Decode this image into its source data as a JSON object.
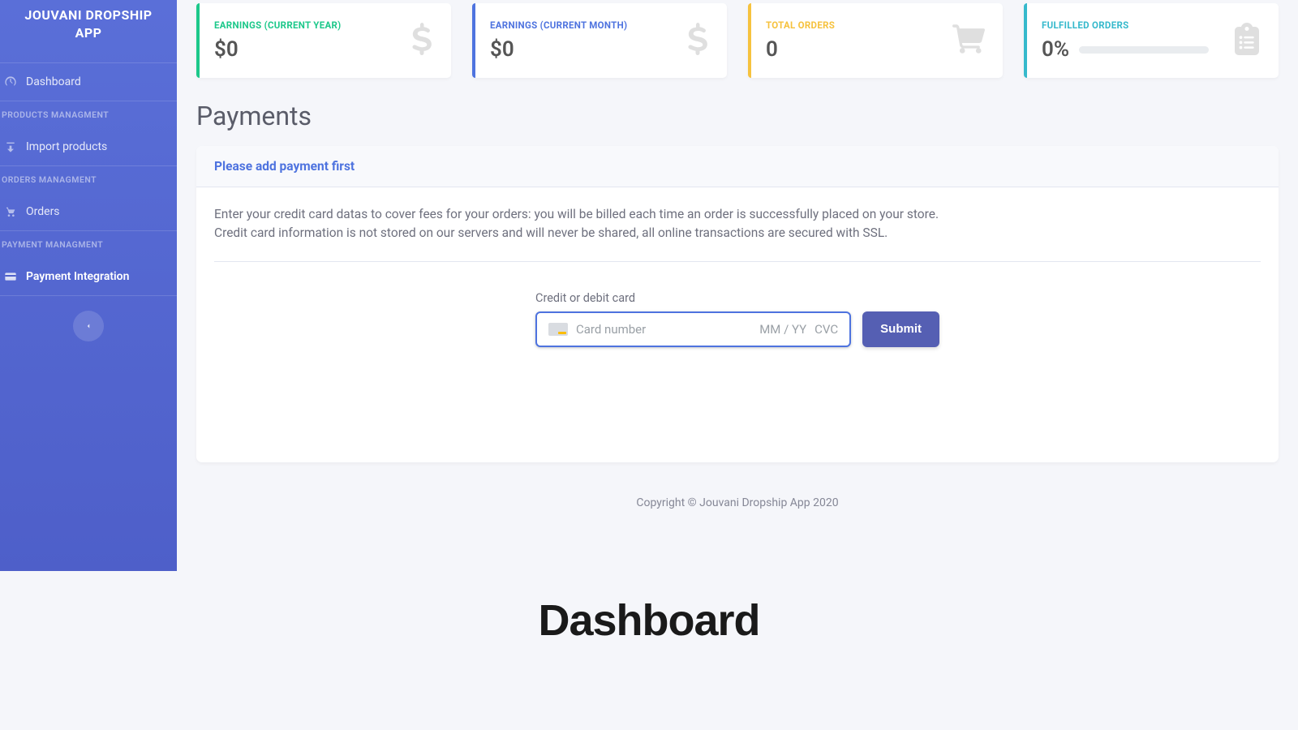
{
  "sidebar": {
    "title": "JOUVANI DROPSHIP APP",
    "items": [
      {
        "label": "Dashboard"
      },
      {
        "section": "PRODUCTS MANAGMENT"
      },
      {
        "label": "Import products"
      },
      {
        "section": "ORDERS MANAGMENT"
      },
      {
        "label": "Orders"
      },
      {
        "section": "PAYMENT MANAGMENT"
      },
      {
        "label": "Payment Integration"
      }
    ]
  },
  "cards": {
    "year": {
      "label": "EARNINGS (CURRENT YEAR)",
      "value": "$0"
    },
    "month": {
      "label": "EARNINGS (CURRENT MONTH)",
      "value": "$0"
    },
    "orders": {
      "label": "TOTAL ORDERS",
      "value": "0"
    },
    "fulfilled": {
      "label": "FULFILLED ORDERS",
      "value": "0%"
    }
  },
  "page": {
    "title": "Payments"
  },
  "panel": {
    "header": "Please add payment first",
    "desc1": "Enter your credit card datas to cover fees for your orders: you will be billed each time an order is successfully placed on your store.",
    "desc2": "Credit card information is not stored on our servers and will never be shared, all online transactions are secured with SSL."
  },
  "form": {
    "label": "Credit or debit card",
    "placeholder": "Card number",
    "expiry": "MM / YY",
    "cvc": "CVC",
    "submit": "Submit"
  },
  "footer": {
    "text": "Copyright © Jouvani Dropship App 2020"
  },
  "bigLabel": "Dashboard"
}
